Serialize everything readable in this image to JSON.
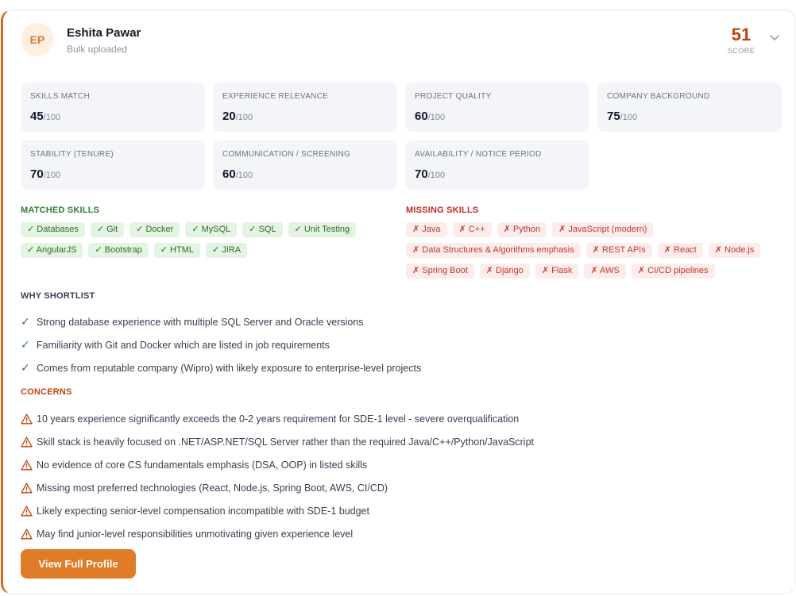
{
  "candidate": {
    "initials": "EP",
    "name": "Eshita Pawar",
    "source": "Bulk uploaded",
    "score": "51",
    "score_label": "SCORE"
  },
  "metrics": [
    {
      "label": "SKILLS MATCH",
      "value": "45",
      "denom": "/100"
    },
    {
      "label": "EXPERIENCE RELEVANCE",
      "value": "20",
      "denom": "/100"
    },
    {
      "label": "PROJECT QUALITY",
      "value": "60",
      "denom": "/100"
    },
    {
      "label": "COMPANY BACKGROUND",
      "value": "75",
      "denom": "/100"
    },
    {
      "label": "STABILITY (TENURE)",
      "value": "70",
      "denom": "/100"
    },
    {
      "label": "COMMUNICATION / SCREENING",
      "value": "60",
      "denom": "/100"
    },
    {
      "label": "AVAILABILITY / NOTICE PERIOD",
      "value": "70",
      "denom": "/100"
    }
  ],
  "matched_skills": {
    "title": "MATCHED SKILLS",
    "items": [
      "✓ Databases",
      "✓ Git",
      "✓ Docker",
      "✓ MySQL",
      "✓ SQL",
      "✓ Unit Testing",
      "✓ AngularJS",
      "✓ Bootstrap",
      "✓ HTML",
      "✓ JIRA"
    ]
  },
  "missing_skills": {
    "title": "MISSING SKILLS",
    "items": [
      "✗ Java",
      "✗ C++",
      "✗ Python",
      "✗ JavaScript (modern)",
      "✗ Data Structures & Algorithms emphasis",
      "✗ REST APIs",
      "✗ React",
      "✗ Node.js",
      "✗ Spring Boot",
      "✗ Django",
      "✗ Flask",
      "✗ AWS",
      "✗ CI/CD pipelines"
    ]
  },
  "why_shortlist": {
    "title": "WHY SHORTLIST",
    "items": [
      "Strong database experience with multiple SQL Server and Oracle versions",
      "Familiarity with Git and Docker which are listed in job requirements",
      "Comes from reputable company (Wipro) with likely exposure to enterprise-level projects"
    ]
  },
  "concerns": {
    "title": "CONCERNS",
    "items": [
      "10 years experience significantly exceeds the 0-2 years requirement for SDE-1 level - severe overqualification",
      "Skill stack is heavily focused on .NET/ASP.NET/SQL Server rather than the required Java/C++/Python/JavaScript",
      "No evidence of core CS fundamentals emphasis (DSA, OOP) in listed skills",
      "Missing most preferred technologies (React, Node.js, Spring Boot, AWS, CI/CD)",
      "Likely expecting senior-level compensation incompatible with SDE-1 budget",
      "May find junior-level responsibilities unmotivating given experience level"
    ]
  },
  "actions": {
    "view_profile": "View Full Profile"
  },
  "colors": {
    "accent": "#e07b27",
    "score": "#c2410c",
    "ok": "#2f7d32",
    "bad": "#c62828"
  }
}
